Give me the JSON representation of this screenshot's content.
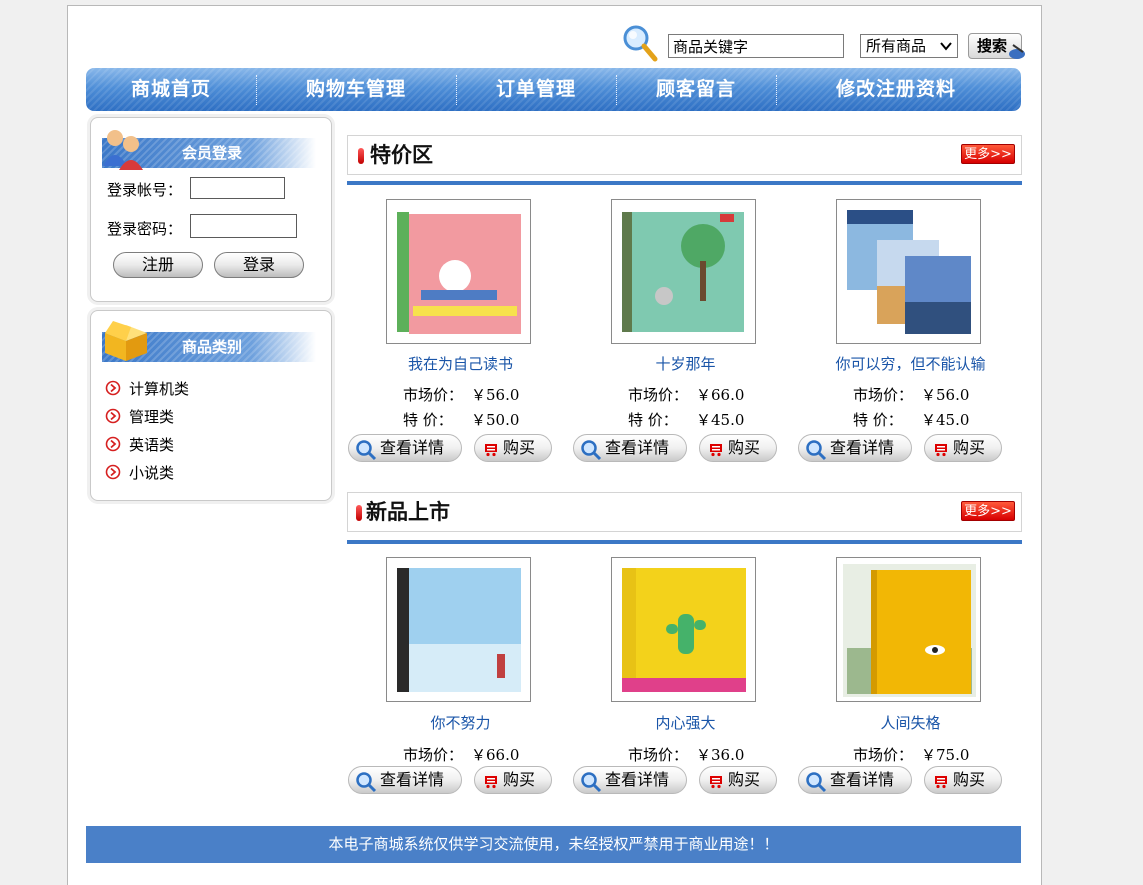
{
  "search": {
    "placeholder": "商品关键字",
    "category_selected": "所有商品",
    "button_label": "搜索"
  },
  "nav": {
    "items": [
      {
        "label": "商城首页"
      },
      {
        "label": "购物车管理"
      },
      {
        "label": "订单管理"
      },
      {
        "label": "顾客留言"
      },
      {
        "label": "修改注册资料"
      }
    ]
  },
  "login": {
    "title": "会员登录",
    "account_label": "登录帐号：",
    "password_label": "登录密码：",
    "register_label": "注册",
    "login_label": "登录"
  },
  "categories": {
    "title": "商品类别",
    "items": [
      {
        "label": "计算机类"
      },
      {
        "label": "管理类"
      },
      {
        "label": "英语类"
      },
      {
        "label": "小说类"
      }
    ]
  },
  "special": {
    "title": "特价区",
    "more_label": "更多>>",
    "products": [
      {
        "name": "我在为自己读书",
        "market_label": "市场价：",
        "market_price": "￥56.0",
        "special_label": "特  价：",
        "special_price": "￥50.0",
        "cover_color": "#f29aa0"
      },
      {
        "name": "十岁那年",
        "market_label": "市场价：",
        "market_price": "￥66.0",
        "special_label": "特  价：",
        "special_price": "￥45.0",
        "cover_color": "#7fc9b0"
      },
      {
        "name": "你可以穷，但不能认输",
        "market_label": "市场价：",
        "market_price": "￥56.0",
        "special_label": "特  价：",
        "special_price": "￥45.0",
        "cover_color": "#5f88c8"
      }
    ]
  },
  "newbooks": {
    "title": "新品上市",
    "more_label": "更多>>",
    "products": [
      {
        "name": "你不努力",
        "market_label": "市场价：",
        "market_price": "￥66.0",
        "cover_color": "#9fd0ef"
      },
      {
        "name": "内心强大",
        "market_label": "市场价：",
        "market_price": "￥36.0",
        "cover_color": "#f3d21b"
      },
      {
        "name": "人间失格",
        "market_label": "市场价：",
        "market_price": "￥75.0",
        "cover_color": "#f2b705"
      }
    ]
  },
  "actions": {
    "detail_label": "查看详情",
    "buy_label": "购买"
  },
  "footer": {
    "text": "本电子商城系统仅供学习交流使用，未经授权严禁用于商业用途！！"
  }
}
